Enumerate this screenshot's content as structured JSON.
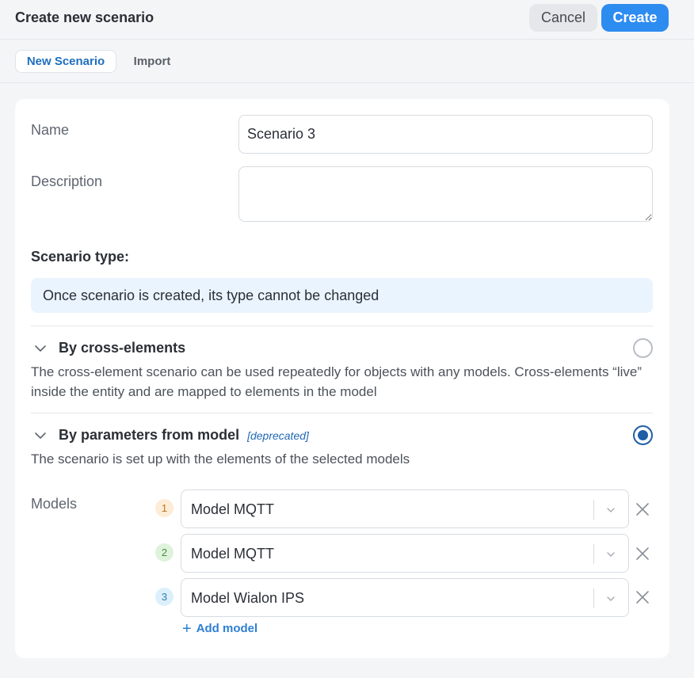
{
  "header": {
    "title": "Create new scenario",
    "cancel_label": "Cancel",
    "create_label": "Create"
  },
  "tabs": [
    {
      "label": "New Scenario",
      "active": true
    },
    {
      "label": "Import",
      "active": false
    }
  ],
  "form": {
    "name_label": "Name",
    "name_value": "Scenario 3",
    "description_label": "Description",
    "description_value": "",
    "scenario_type_label": "Scenario type:",
    "info_text": "Once scenario is created, its type cannot be changed"
  },
  "options": [
    {
      "title": "By cross-elements",
      "tag": "",
      "description": "The cross-element scenario can be used repeatedly for objects with any models. Cross-elements “live” inside the entity and are mapped to elements in the model",
      "selected": false,
      "icon": "chevron-down-icon"
    },
    {
      "title": "By parameters from model",
      "tag": "[deprecated]",
      "description": "The scenario is set up with the elements of the selected models",
      "selected": true,
      "icon": "chevron-down-icon"
    }
  ],
  "models": {
    "label": "Models",
    "items": [
      {
        "index": "1",
        "value": "Model MQTT",
        "badge_bg": "#fdecd6",
        "badge_fg": "#b9772a"
      },
      {
        "index": "2",
        "value": "Model MQTT",
        "badge_bg": "#dff3dc",
        "badge_fg": "#4a8a3f"
      },
      {
        "index": "3",
        "value": "Model Wialon IPS",
        "badge_bg": "#dcf0fb",
        "badge_fg": "#2f7fb0"
      }
    ],
    "add_label": "Add model"
  },
  "colors": {
    "accent": "#2d8cf0",
    "radio_selected": "#1f5fa8",
    "info_bg": "#eaf4ff",
    "tag_color": "#2068b4"
  }
}
